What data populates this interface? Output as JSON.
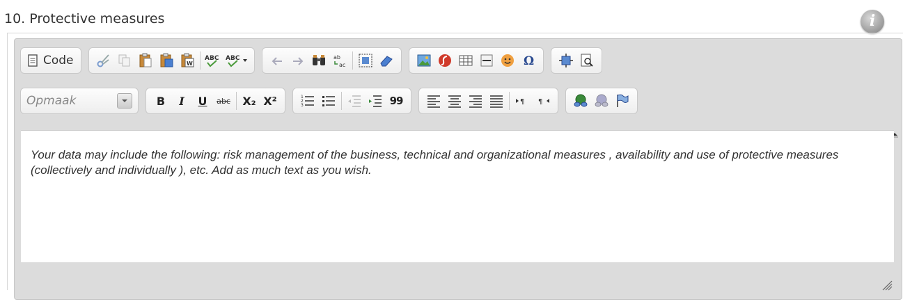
{
  "section": {
    "title": "10. Protective measures"
  },
  "info": {
    "glyph": "i"
  },
  "toolbar": {
    "code_label": "Code",
    "format_placeholder": "Opmaak",
    "bold": "B",
    "italic": "I",
    "underline": "U",
    "strike": "abc",
    "sub": "X₂",
    "sup": "X²",
    "blockquote": "99",
    "spell1": "ABC",
    "spell2": "ABC"
  },
  "editor": {
    "content": "Your data may include the following: risk management of the business, technical and organizational measures , availability and use of protective measures (collectively and individually ), etc. Add as much text as you wish."
  },
  "colors": {
    "editor_bg": "#dcdcdc",
    "group_border": "#c9c9c9"
  }
}
